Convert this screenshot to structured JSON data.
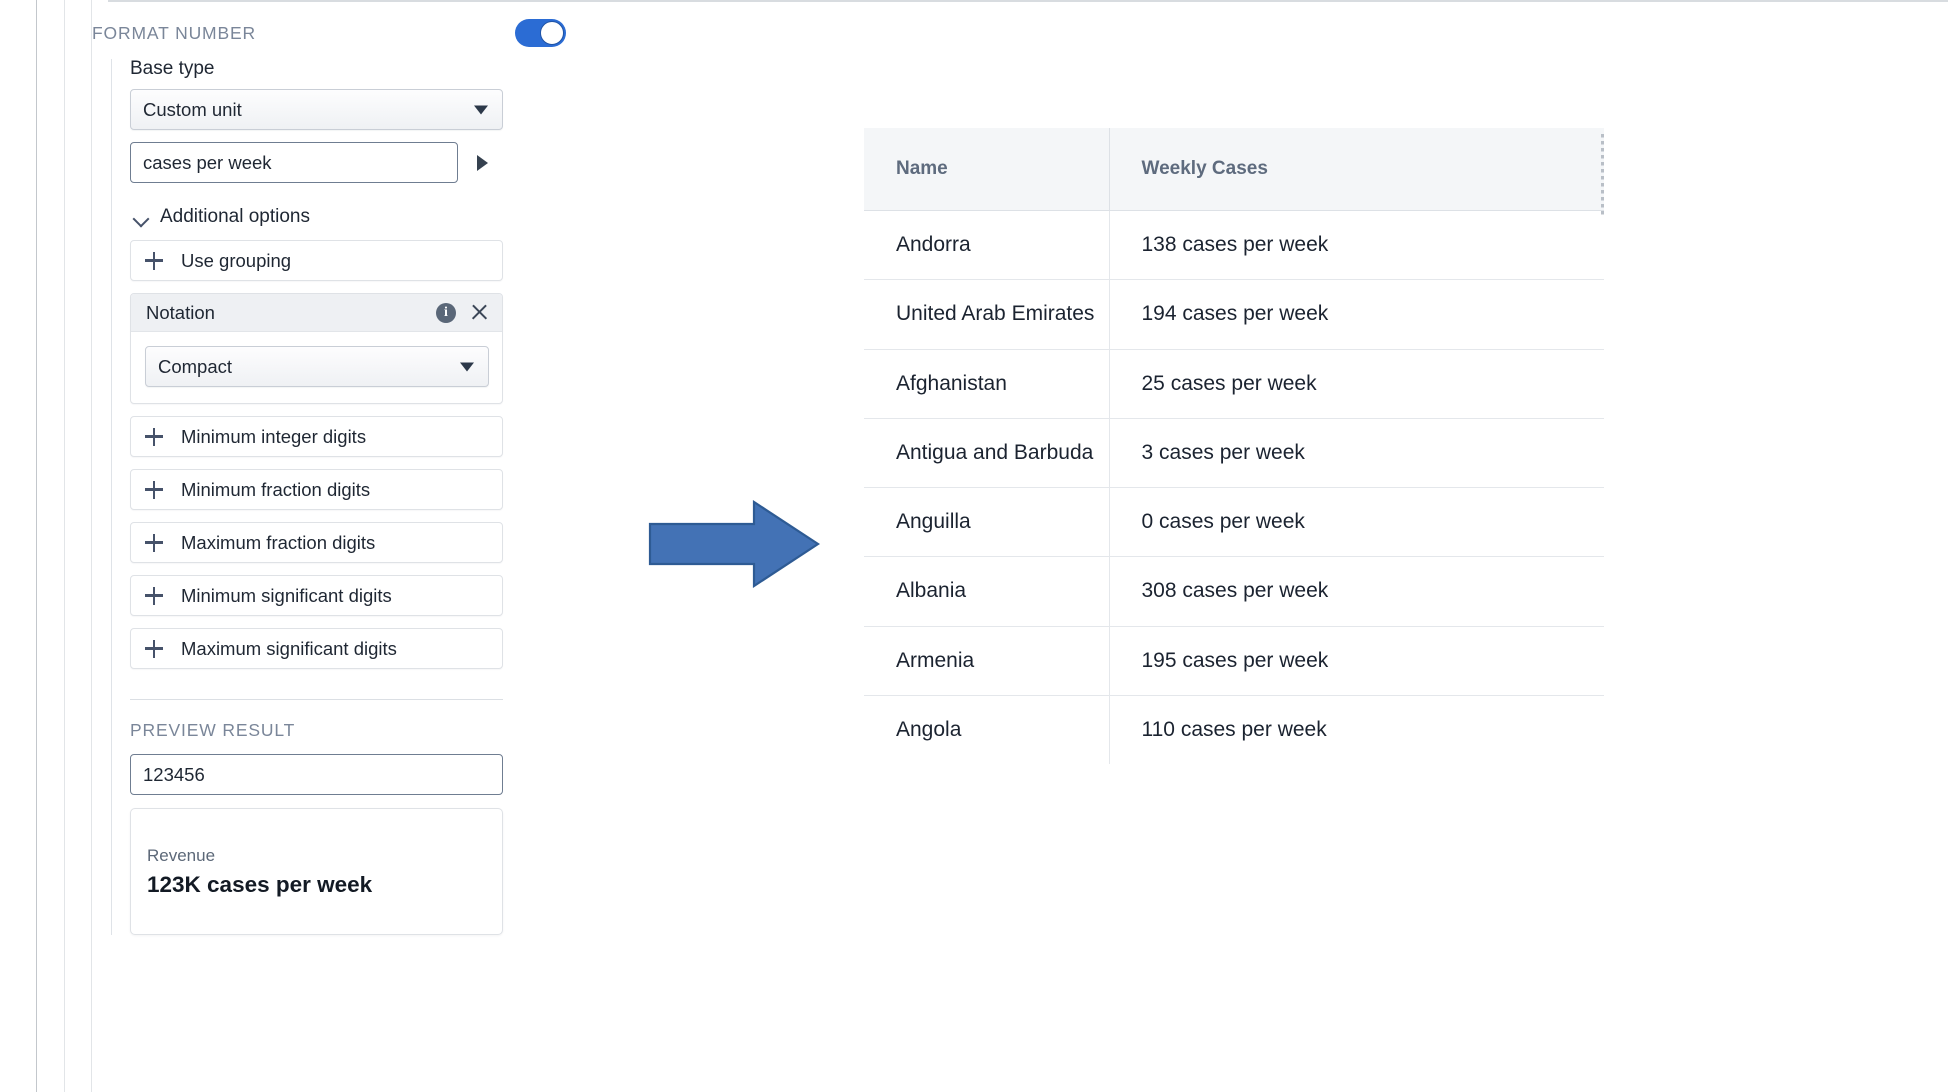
{
  "panel": {
    "title": "FORMAT NUMBER",
    "toggle_on": true,
    "base_type_label": "Base type",
    "base_type_value": "Custom unit",
    "custom_unit_value": "cases per week",
    "additional_options_label": "Additional options",
    "use_grouping_label": "Use grouping",
    "notation": {
      "title": "Notation",
      "value": "Compact"
    },
    "digit_options": [
      {
        "label": "Minimum integer digits"
      },
      {
        "label": "Minimum fraction digits"
      },
      {
        "label": "Maximum fraction digits"
      },
      {
        "label": "Minimum significant digits"
      },
      {
        "label": "Maximum significant digits"
      }
    ],
    "preview": {
      "section_label": "PREVIEW RESULT",
      "input_value": "123456",
      "card_caption": "Revenue",
      "card_value": "123K cases per week"
    }
  },
  "arrow": {
    "direction": "right",
    "fill": "#4372b5",
    "stroke": "#2e5b94"
  },
  "table": {
    "columns": [
      "Name",
      "Weekly Cases"
    ],
    "rows": [
      {
        "name": "Andorra",
        "cases": "138 cases per week"
      },
      {
        "name": "United Arab Emirates",
        "cases": "194 cases per week"
      },
      {
        "name": "Afghanistan",
        "cases": "25 cases per week"
      },
      {
        "name": "Antigua and Barbuda",
        "cases": "3 cases per week"
      },
      {
        "name": "Anguilla",
        "cases": "0 cases per week"
      },
      {
        "name": "Albania",
        "cases": "308 cases per week"
      },
      {
        "name": "Armenia",
        "cases": "195 cases per week"
      },
      {
        "name": "Angola",
        "cases": "110 cases per week"
      }
    ]
  },
  "colors": {
    "accent_blue": "#2b6cd4",
    "arrow_blue": "#4372b5",
    "header_bg": "#f4f6f8",
    "muted_text": "#7a8699"
  }
}
